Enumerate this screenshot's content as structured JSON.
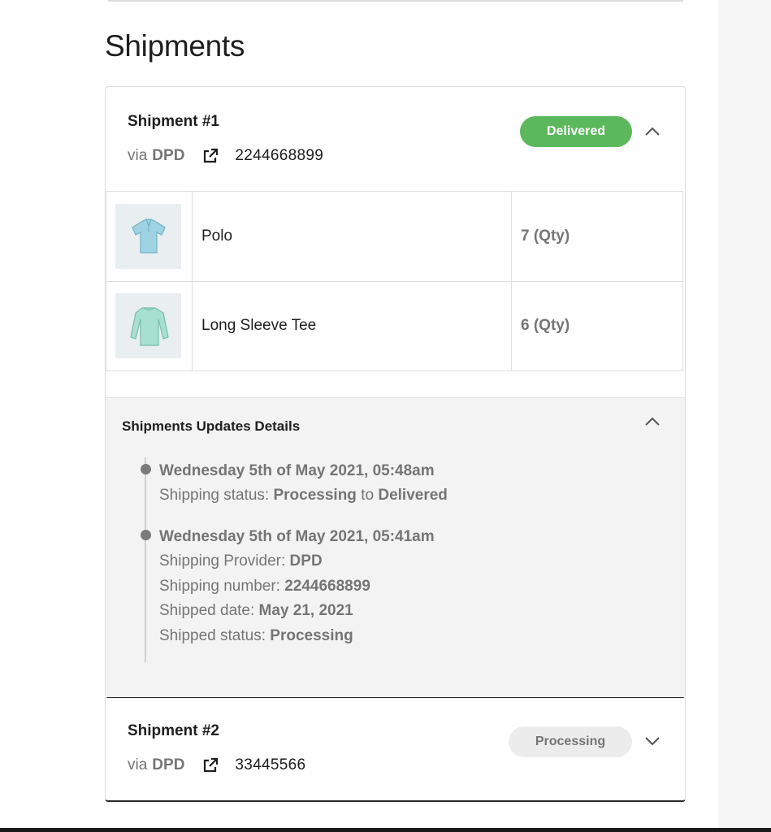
{
  "page": {
    "section_title": "Shipments"
  },
  "shipments": [
    {
      "title": "Shipment #1",
      "via_label": "via",
      "carrier": "DPD",
      "tracking_number": "2244668899",
      "status": "Delivered",
      "expanded": true,
      "items": [
        {
          "name": "Polo",
          "qty": "7 (Qty)",
          "thumbnail": "polo-shirt-image"
        },
        {
          "name": "Long Sleeve Tee",
          "qty": "6 (Qty)",
          "thumbnail": "long-sleeve-tee-image"
        }
      ],
      "updates": {
        "title": "Shipments Updates Details",
        "events": [
          {
            "date": "Wednesday 5th of May 2021, 05:48am",
            "status_label": "Shipping status:",
            "from": "Processing",
            "to_word": "to",
            "to": "Delivered"
          },
          {
            "date": "Wednesday 5th of May 2021, 05:41am",
            "provider_label": "Shipping Provider:",
            "provider": "DPD",
            "number_label": "Shipping number:",
            "number": "2244668899",
            "shipped_date_label": "Shipped date:",
            "shipped_date": "May 21, 2021",
            "shipped_status_label": "Shipped status:",
            "shipped_status": "Processing"
          }
        ]
      }
    },
    {
      "title": "Shipment #2",
      "via_label": "via",
      "carrier": "DPD",
      "tracking_number": "33445566",
      "status": "Processing",
      "expanded": false
    }
  ],
  "icons": {
    "external_link": "external-link-icon",
    "collapse": "chevron-up-icon",
    "expand": "chevron-down-icon",
    "timeline_dot": "timeline-dot"
  },
  "colors": {
    "delivered_badge": "#5cb85c",
    "processing_badge": "#ececec",
    "muted_text": "#757575",
    "updates_panel": "#f3f3f3"
  }
}
